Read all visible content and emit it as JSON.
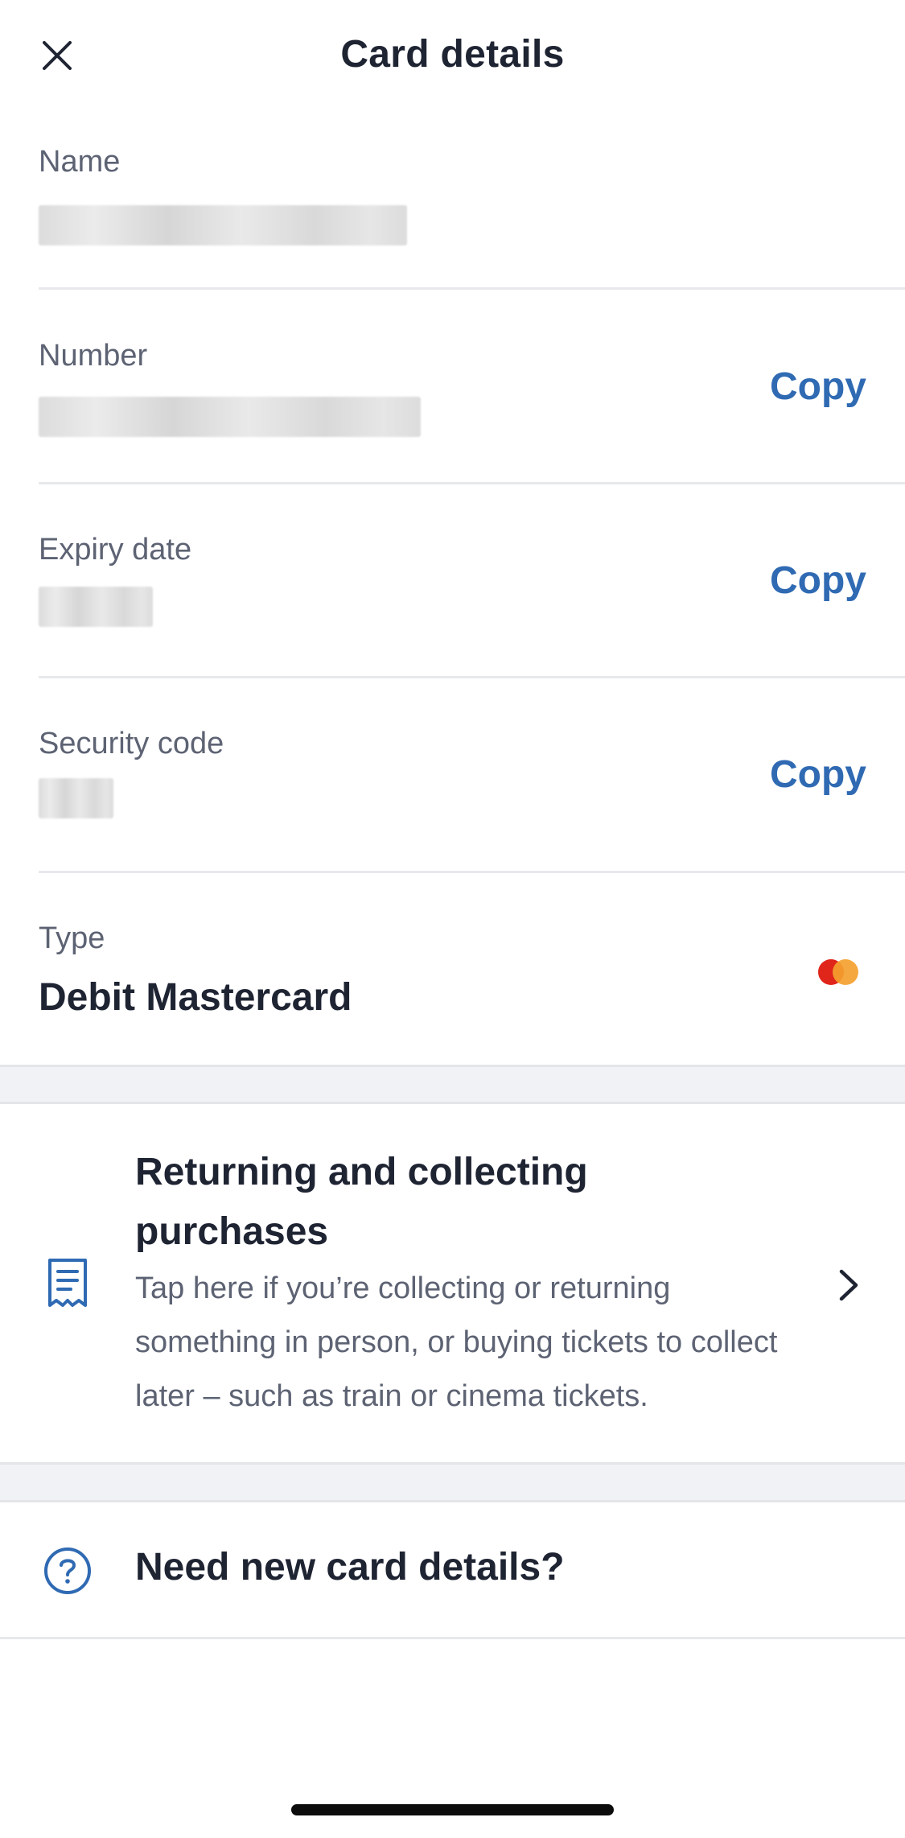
{
  "header": {
    "title": "Card details",
    "close_icon": "close-icon"
  },
  "fields": {
    "name": {
      "label": "Name"
    },
    "number": {
      "label": "Number",
      "copy_label": "Copy"
    },
    "expiry": {
      "label": "Expiry date",
      "copy_label": "Copy"
    },
    "security": {
      "label": "Security code",
      "copy_label": "Copy"
    },
    "type": {
      "label": "Type",
      "value": "Debit Mastercard",
      "logo": "mastercard-logo"
    }
  },
  "info_card": {
    "icon": "receipt-icon",
    "title": "Returning and collecting purchases",
    "description": "Tap here if you’re collecting or returning something in person, or buying tickets to collect later – such as train or cinema tickets.",
    "chevron": "chevron-right-icon"
  },
  "help": {
    "icon": "question-circle-icon",
    "label": "Need new card details?"
  },
  "colors": {
    "accent": "#2f6ab3",
    "text_primary": "#1f2433",
    "text_secondary": "#5d6373",
    "divider": "#e8e9ec",
    "band": "#f1f2f5",
    "mastercard_red": "#e0251b",
    "mastercard_orange": "#f4a12f"
  }
}
